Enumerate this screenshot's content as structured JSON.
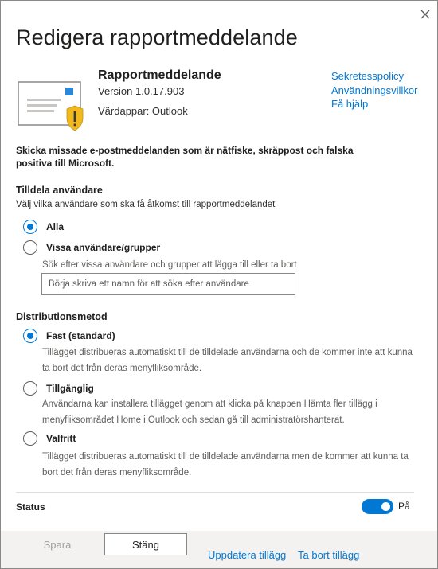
{
  "dialog": {
    "title": "Redigera rapportmeddelande",
    "close_icon": "close-icon"
  },
  "app": {
    "icon": "envelope-warning-icon",
    "name": "Rapportmeddelande",
    "version": "Version 1.0.17.903",
    "host": "Värdappar: Outlook",
    "links": [
      "Sekretesspolicy",
      "Användningsvillkor",
      "Få hjälp"
    ]
  },
  "description": "Skicka missade e-postmeddelanden som är nätfiske, skräppost och falska positiva till Microsoft.",
  "assign": {
    "heading": "Tilldela användare",
    "subheading": "Välj vilka användare som ska få åtkomst till rapportmeddelandet",
    "options": [
      {
        "label": "Alla",
        "checked": true
      },
      {
        "label": "Vissa användare/grupper",
        "checked": false
      }
    ],
    "search_hint": "Sök efter vissa användare och grupper att lägga till eller ta bort",
    "search_placeholder": "Börja skriva ett namn för att söka efter användare"
  },
  "distribution": {
    "heading": "Distributionsmetod",
    "options": [
      {
        "label": "Fast (standard)",
        "checked": true,
        "note": "Tillägget distribueras automatiskt till de tilldelade användarna och de kommer inte att kunna ta bort det från deras menyfliksområde."
      },
      {
        "label": "Tillgänglig",
        "checked": false,
        "note": "Användarna kan installera tillägget genom att klicka på knappen Hämta fler tillägg i menyfliksområdet Home i Outlook och sedan gå till administratörshanterat."
      },
      {
        "label": "Valfritt",
        "checked": false,
        "note": "Tillägget distribueras automatiskt till de tilldelade användarna men de kommer att kunna ta bort det från deras menyfliksområde."
      }
    ]
  },
  "status": {
    "label": "Status",
    "toggle_on": true,
    "toggle_text": "På"
  },
  "footer": {
    "save_label": "Spara",
    "close_label": "Stäng",
    "update_link": "Uppdatera tillägg",
    "remove_link": "Ta bort tillägg"
  },
  "colors": {
    "accent": "#0078d4",
    "warning": "#f2b91e",
    "footer_bg": "#f3f2f1"
  }
}
